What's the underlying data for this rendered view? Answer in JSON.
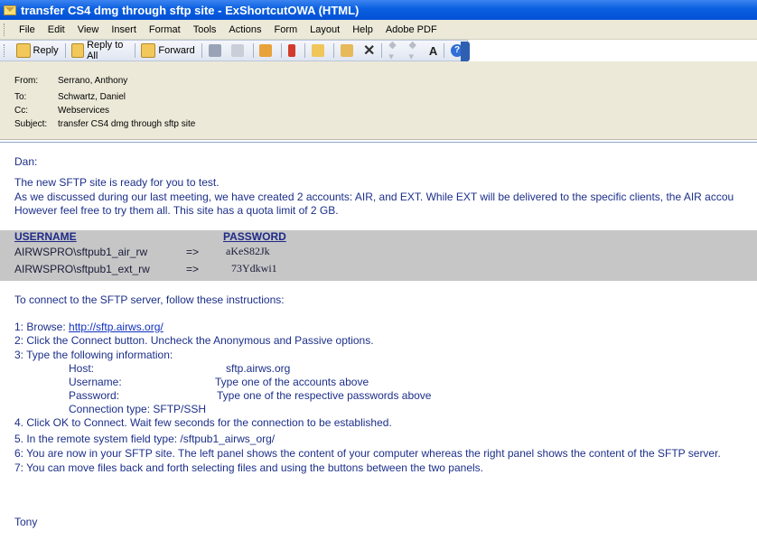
{
  "window": {
    "title": "transfer CS4 dmg through sftp site - ExShortcutOWA (HTML)"
  },
  "menu": [
    "File",
    "Edit",
    "View",
    "Insert",
    "Format",
    "Tools",
    "Actions",
    "Form",
    "Layout",
    "Help",
    "Adobe PDF"
  ],
  "toolbar": {
    "reply": "Reply",
    "reply_all": "Reply to All",
    "forward": "Forward"
  },
  "header": {
    "from_label": "From:",
    "from": "Serrano, Anthony",
    "to_label": "To:",
    "to": "Schwartz, Daniel",
    "cc_label": "Cc:",
    "cc": "Webservices",
    "subject_label": "Subject:",
    "subject": "transfer CS4 dmg through sftp site"
  },
  "body": {
    "greeting": "Dan:",
    "p1": "The new SFTP site is ready for you to test.",
    "p2": "As we discussed during our last meeting, we have created 2 accounts: AIR, and EXT. While EXT will be delivered to the specific clients, the AIR accou",
    "p3": "However feel free to try them all.  This site has a quota limit of 2 GB.",
    "creds": {
      "username_header": "USERNAME",
      "password_header": "PASSWORD",
      "rows": [
        {
          "user": "AIRWSPRO\\sftpub1_air_rw",
          "arrow": "=>",
          "pass": "aKeS82Jk"
        },
        {
          "user": "AIRWSPRO\\sftpub1_ext_rw",
          "arrow": "=>",
          "pass": "73Ydkwi1"
        }
      ]
    },
    "connect_intro": "To connect to the SFTP server, follow these instructions:",
    "step1_prefix": "1: Browse: ",
    "step1_link": "http://sftp.airws.org/",
    "step2": "2: Click the Connect button. Uncheck the Anonymous and Passive options.",
    "step3": "3: Type the following information:",
    "host_label": "Host:",
    "host_value": "sftp.airws.org",
    "username_label": "Username:",
    "username_value": "Type one of the accounts above",
    "password_label": "Password:",
    "password_value": "Type one of the respective passwords above",
    "conn_type": "Connection type:  SFTP/SSH",
    "step4": "4. Click OK to Connect. Wait few seconds for the connection to be established.",
    "step5": "5. In the remote system field type: /sftpub1_airws_org/",
    "step6": "6: You are now in your SFTP site. The left panel shows the content of your computer whereas the right panel shows the content of the SFTP server.",
    "step7": "7: You can move files back and forth selecting files and using the buttons between the two panels.",
    "signature": "Tony"
  }
}
